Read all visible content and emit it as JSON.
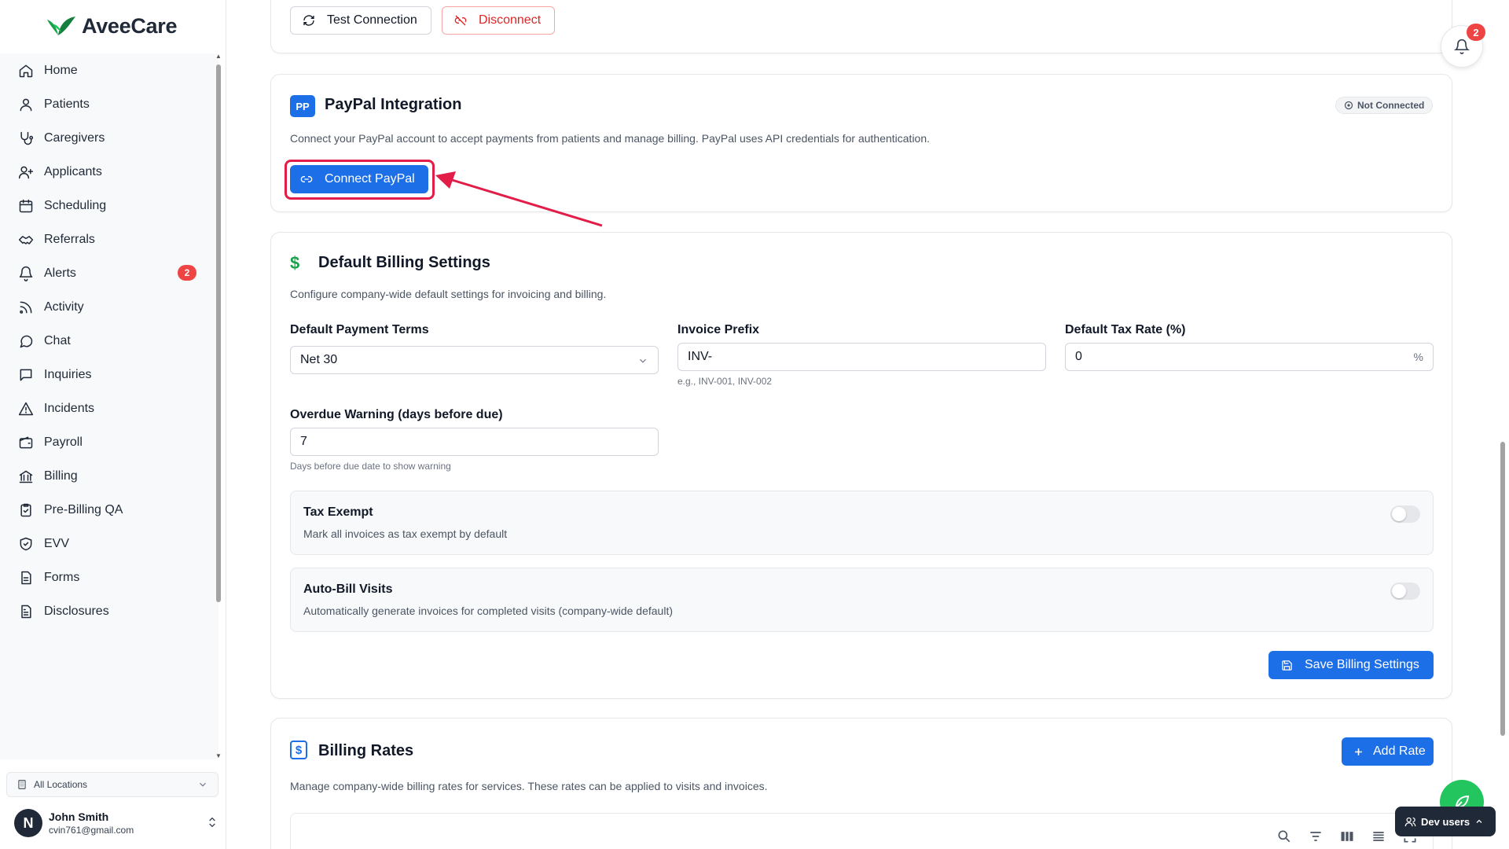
{
  "app": {
    "name": "AveeCare"
  },
  "sidebar": {
    "items": [
      {
        "label": "Home",
        "icon": "home-icon"
      },
      {
        "label": "Patients",
        "icon": "user-icon"
      },
      {
        "label": "Caregivers",
        "icon": "stethoscope-icon"
      },
      {
        "label": "Applicants",
        "icon": "user-plus-icon"
      },
      {
        "label": "Scheduling",
        "icon": "calendar-icon"
      },
      {
        "label": "Referrals",
        "icon": "handshake-icon"
      },
      {
        "label": "Alerts",
        "icon": "bell-icon",
        "badge": "2"
      },
      {
        "label": "Activity",
        "icon": "rss-icon"
      },
      {
        "label": "Chat",
        "icon": "chat-bubble-icon"
      },
      {
        "label": "Inquiries",
        "icon": "message-square-icon"
      },
      {
        "label": "Incidents",
        "icon": "warning-triangle-icon"
      },
      {
        "label": "Payroll",
        "icon": "wallet-icon"
      },
      {
        "label": "Billing",
        "icon": "bank-icon"
      },
      {
        "label": "Pre-Billing QA",
        "icon": "clipboard-check-icon"
      },
      {
        "label": "EVV",
        "icon": "shield-check-icon"
      },
      {
        "label": "Forms",
        "icon": "document-icon"
      },
      {
        "label": "Disclosures",
        "icon": "file-text-icon"
      }
    ],
    "location": "All Locations",
    "user": {
      "initial": "N",
      "name": "John Smith",
      "email": "cvin761@gmail.com"
    }
  },
  "prev_card": {
    "test_label": "Test Connection",
    "disconnect_label": "Disconnect"
  },
  "paypal": {
    "logo": "PP",
    "title": "PayPal Integration",
    "status": "Not Connected",
    "description": "Connect your PayPal account to accept payments from patients and manage billing. PayPal uses API credentials for authentication.",
    "connect_label": "Connect PayPal"
  },
  "billing_settings": {
    "title": "Default Billing Settings",
    "description": "Configure company-wide default settings for invoicing and billing.",
    "payment_terms_label": "Default Payment Terms",
    "payment_terms_value": "Net 30",
    "invoice_prefix_label": "Invoice Prefix",
    "invoice_prefix_value": "INV-",
    "invoice_prefix_help": "e.g., INV-001, INV-002",
    "tax_rate_label": "Default Tax Rate (%)",
    "tax_rate_value": "0",
    "tax_rate_suffix": "%",
    "overdue_label": "Overdue Warning (days before due)",
    "overdue_value": "7",
    "overdue_help": "Days before due date to show warning",
    "tax_exempt_title": "Tax Exempt",
    "tax_exempt_desc": "Mark all invoices as tax exempt by default",
    "tax_exempt_on": false,
    "auto_bill_title": "Auto-Bill Visits",
    "auto_bill_desc": "Automatically generate invoices for completed visits (company-wide default)",
    "auto_bill_on": false,
    "save_label": "Save Billing Settings"
  },
  "billing_rates": {
    "title": "Billing Rates",
    "description": "Manage company-wide billing rates for services. These rates can be applied to visits and invoices.",
    "add_label": "Add Rate"
  },
  "notifications": {
    "count": "2"
  },
  "dev_users_label": "Dev users",
  "colors": {
    "primary": "#1d6fe8",
    "danger": "#dc2626",
    "badge": "#ef4444",
    "accent_green": "#22c55e",
    "highlight": "#e11d48"
  }
}
